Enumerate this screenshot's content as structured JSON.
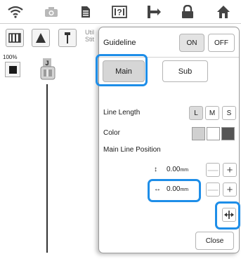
{
  "toolbar": {
    "icons": [
      "wifi-icon",
      "camera-icon",
      "document-icon",
      "help-icon",
      "thread-icon",
      "lock-icon",
      "home-icon"
    ]
  },
  "secondary": {
    "util_line1": "Util",
    "util_line2": "Stit"
  },
  "left": {
    "zoom_label": "100%",
    "foot_letter": "J"
  },
  "dialog": {
    "title": "Guideline",
    "on_label": "ON",
    "off_label": "OFF",
    "tabs": [
      {
        "label": "Main",
        "selected": true
      },
      {
        "label": "Sub",
        "selected": false
      }
    ],
    "line_length_label": "Line Length",
    "sizes": [
      {
        "label": "L",
        "selected": true
      },
      {
        "label": "M",
        "selected": false
      },
      {
        "label": "S",
        "selected": false
      }
    ],
    "color_label": "Color",
    "colors": [
      "#d0d0d0",
      "#ffffff",
      "#555555"
    ],
    "main_line_position_label": "Main Line Position",
    "vertical": {
      "icon": "↕",
      "value": "0.00",
      "unit": "mm"
    },
    "horizontal": {
      "icon": "↔",
      "value": "0.00",
      "unit": "mm"
    },
    "minus_symbol": "—",
    "plus_symbol": "+",
    "close_label": "Close"
  },
  "highlight_color": "#1e8ee8"
}
